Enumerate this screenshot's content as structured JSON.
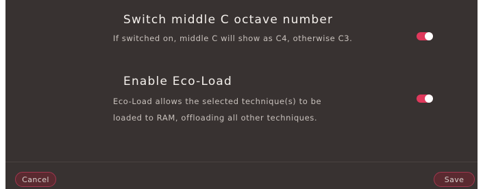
{
  "settings": [
    {
      "title": "Switch middle C octave number",
      "description_lines": [
        "If switched on, middle C will show as C4, otherwise C3."
      ],
      "enabled": true
    },
    {
      "title": "Enable Eco-Load",
      "description_lines": [
        "Eco-Load allows the selected technique(s) to be",
        "loaded to RAM, offloading all other techniques."
      ],
      "enabled": true
    }
  ],
  "footer": {
    "cancel_label": "Cancel",
    "save_label": "Save"
  },
  "colors": {
    "panel_bg": "#383231",
    "toggle_on": "#e0395c",
    "button_border": "#a2364f"
  }
}
